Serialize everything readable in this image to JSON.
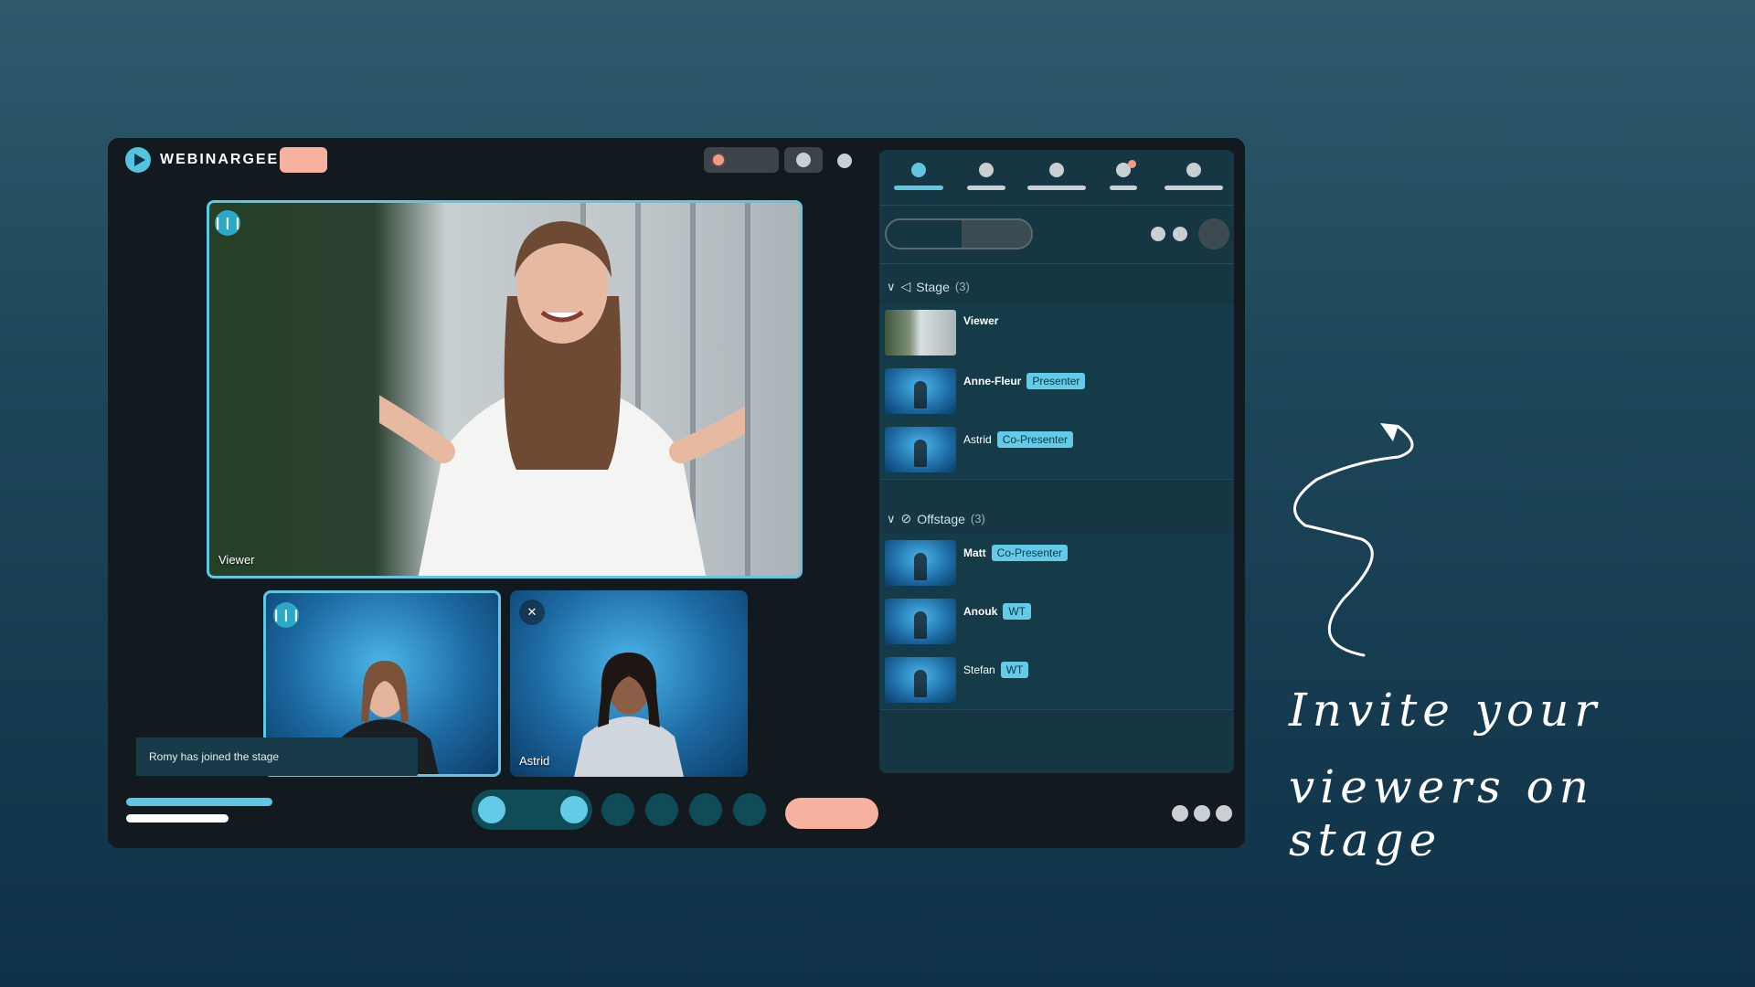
{
  "app": {
    "brand": "WEBINARGEEK"
  },
  "stage": {
    "main_video_label": "Viewer",
    "small_videos": [
      {
        "label": "",
        "state": "speaking"
      },
      {
        "label": "Astrid",
        "state": "muted"
      }
    ],
    "toast": "Romy has joined the stage"
  },
  "panel": {
    "sections": [
      {
        "title": "Stage",
        "count": "(3)"
      },
      {
        "title": "Offstage",
        "count": "(3)"
      }
    ],
    "stage_rows": [
      {
        "name": "Viewer",
        "role": ""
      },
      {
        "name": "Anne-Fleur",
        "role": "Presenter"
      },
      {
        "name": "Astrid",
        "role": "Co-Presenter"
      }
    ],
    "offstage_rows": [
      {
        "name": "Matt",
        "role": "Co-Presenter"
      },
      {
        "name": "Anouk",
        "role": "WT"
      },
      {
        "name": "Stefan",
        "role": "WT"
      }
    ]
  },
  "tagline": {
    "line1": "Invite your",
    "line2": "viewers on stage"
  },
  "colors": {
    "accent": "#5ec7e2",
    "leave": "#f7b19f",
    "panel": "#163643",
    "app_bg": "#121a1f"
  },
  "icons": {
    "speaking": "audio-wave-icon",
    "muted": "mic-off-icon",
    "stage": "megaphone-icon",
    "offstage": "megaphone-off-icon"
  }
}
